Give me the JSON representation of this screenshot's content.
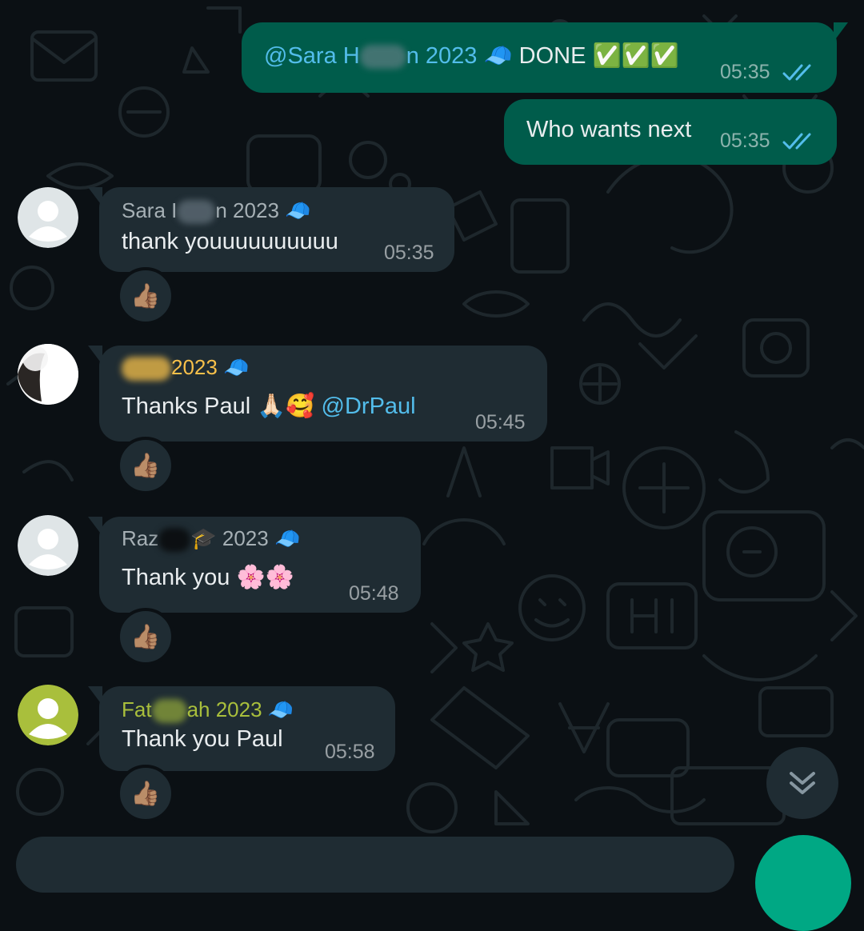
{
  "chat": {
    "messages": [
      {
        "direction": "outgoing",
        "mention": "@Sara H",
        "mention_tail": "n 2023",
        "cap_emoji": "🧢",
        "text": "DONE",
        "check_emojis": "✅✅✅",
        "time": "05:35",
        "status": "read"
      },
      {
        "direction": "outgoing",
        "text": "Who wants next",
        "time": "05:35",
        "status": "read"
      },
      {
        "direction": "incoming",
        "sender_prefix": "Sara I",
        "sender_suffix": "n 2023",
        "sender_emoji": "🧢",
        "sender_color": "#a6b0b5",
        "text": "thank youuuuuuuuuu",
        "time": "05:35",
        "reaction": "👍🏽"
      },
      {
        "direction": "incoming",
        "sender_prefix": "",
        "sender_suffix": "2023",
        "sender_emoji": "🧢",
        "sender_color": "#f7c04a",
        "text": "Thanks Paul",
        "emojis": "🙏🏻🥰",
        "mention": "@DrPaul",
        "time": "05:45",
        "reaction": "👍🏽"
      },
      {
        "direction": "incoming",
        "sender_prefix": "Raz",
        "sender_mid_emoji": "🎓",
        "sender_suffix": "2023",
        "sender_emoji": "🧢",
        "sender_color": "#a6b0b5",
        "text": "Thank you",
        "emojis": "🌸🌸",
        "time": "05:48",
        "reaction": "👍🏽"
      },
      {
        "direction": "incoming",
        "sender_prefix": "Fat",
        "sender_suffix": "ah 2023",
        "sender_emoji": "🧢",
        "sender_color": "#a9bf3c",
        "text": "Thank you Paul",
        "time": "05:58",
        "reaction": "👍🏽"
      }
    ]
  },
  "colors": {
    "background": "#0b1014",
    "outgoing_bubble": "#005c4b",
    "incoming_bubble": "#1f2c33",
    "read_ticks": "#53bdeb",
    "mention": "#53bdeb",
    "accent": "#00a884"
  },
  "icons": {
    "read_receipt": "double-check-icon",
    "scroll_down": "double-chevron-down-icon",
    "default_avatar": "person-silhouette-icon"
  }
}
